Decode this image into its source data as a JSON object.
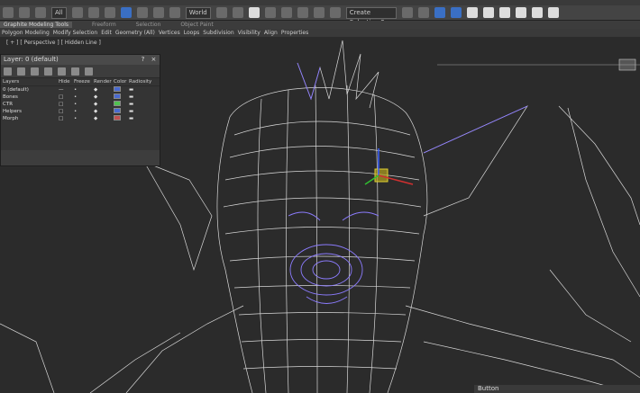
{
  "toolbar": {
    "filter_value": "All",
    "ref_coord": "World",
    "named_sel": "Create Selection Se",
    "icons": [
      "undo-icon",
      "redo-icon",
      "link-icon",
      "unlink-icon",
      "select-icon",
      "select-region-icon",
      "move-icon",
      "rotate-icon",
      "scale-icon",
      "snap-icon",
      "angle-snap-icon",
      "mirror-icon",
      "align-icon",
      "layer-icon",
      "curve-editor-icon",
      "schematic-icon",
      "material-icon",
      "render-setup-icon",
      "render-icon"
    ]
  },
  "ribbon": {
    "tabs": [
      "Graphite Modeling Tools",
      "Freeform",
      "Selection",
      "Object Paint"
    ],
    "sub_items": [
      "Polygon Modeling",
      "Modify Selection",
      "Edit",
      "Geometry (All)",
      "Vertices",
      "Loops",
      "Subdivision",
      "Visibility",
      "Align",
      "Properties"
    ]
  },
  "viewport": {
    "label": "[ + ] [ Perspective ] [ Hidden Line ]"
  },
  "layer_panel": {
    "title": "Layer: 0 (default)",
    "columns": [
      "Layers",
      "Hide",
      "Freeze",
      "Render",
      "Color",
      "Radiosity"
    ],
    "rows": [
      {
        "name": "0 (default)",
        "color": "#4a6ad0"
      },
      {
        "name": "Bones",
        "color": "#4a6ad0"
      },
      {
        "name": "CTR",
        "color": "#50c050"
      },
      {
        "name": "Helpers",
        "color": "#4a6ad0"
      },
      {
        "name": "Morph",
        "color": "#c05050"
      }
    ]
  },
  "status_bar": {
    "text": "Button"
  }
}
